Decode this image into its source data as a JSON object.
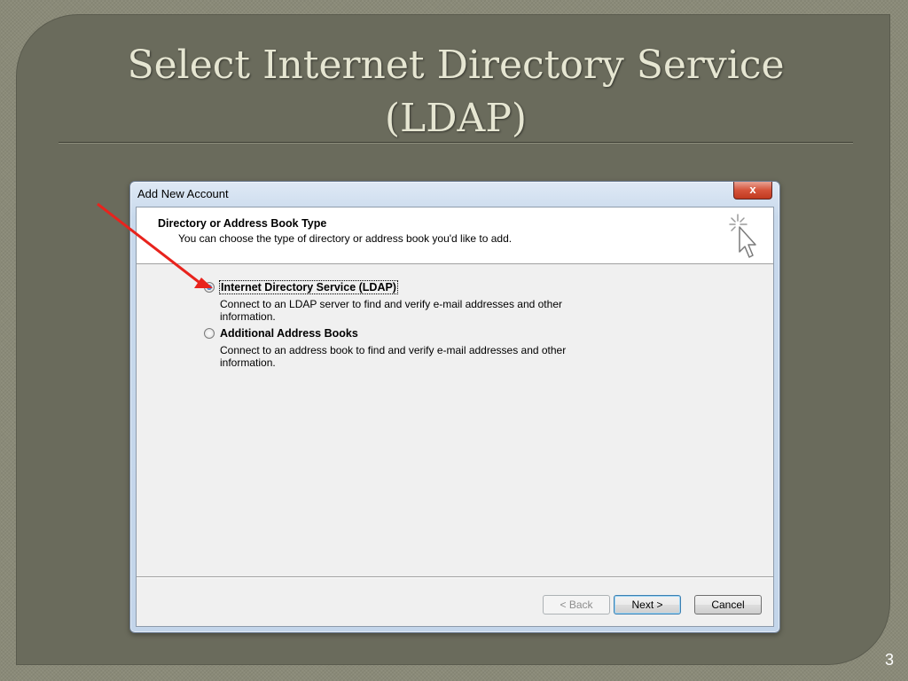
{
  "slide": {
    "title": "Select Internet Directory Service (LDAP)",
    "page_number": "3"
  },
  "dialog": {
    "title": "Add New Account",
    "close_label": "x",
    "header": {
      "title": "Directory or Address Book Type",
      "subtitle": "You can choose the type of directory or address book you'd like to add."
    },
    "options": [
      {
        "label": "Internet Directory Service (LDAP)",
        "description": "Connect to an LDAP server to find and verify e-mail addresses and other information.",
        "selected": true
      },
      {
        "label": "Additional Address Books",
        "description": "Connect to an address book to find and verify e-mail addresses and other information.",
        "selected": false
      }
    ],
    "buttons": {
      "back": "< Back",
      "next": "Next >",
      "cancel": "Cancel"
    }
  },
  "colors": {
    "panel": "#6a6b5c",
    "title_text": "#e6e6d2",
    "arrow": "#e8231d"
  }
}
